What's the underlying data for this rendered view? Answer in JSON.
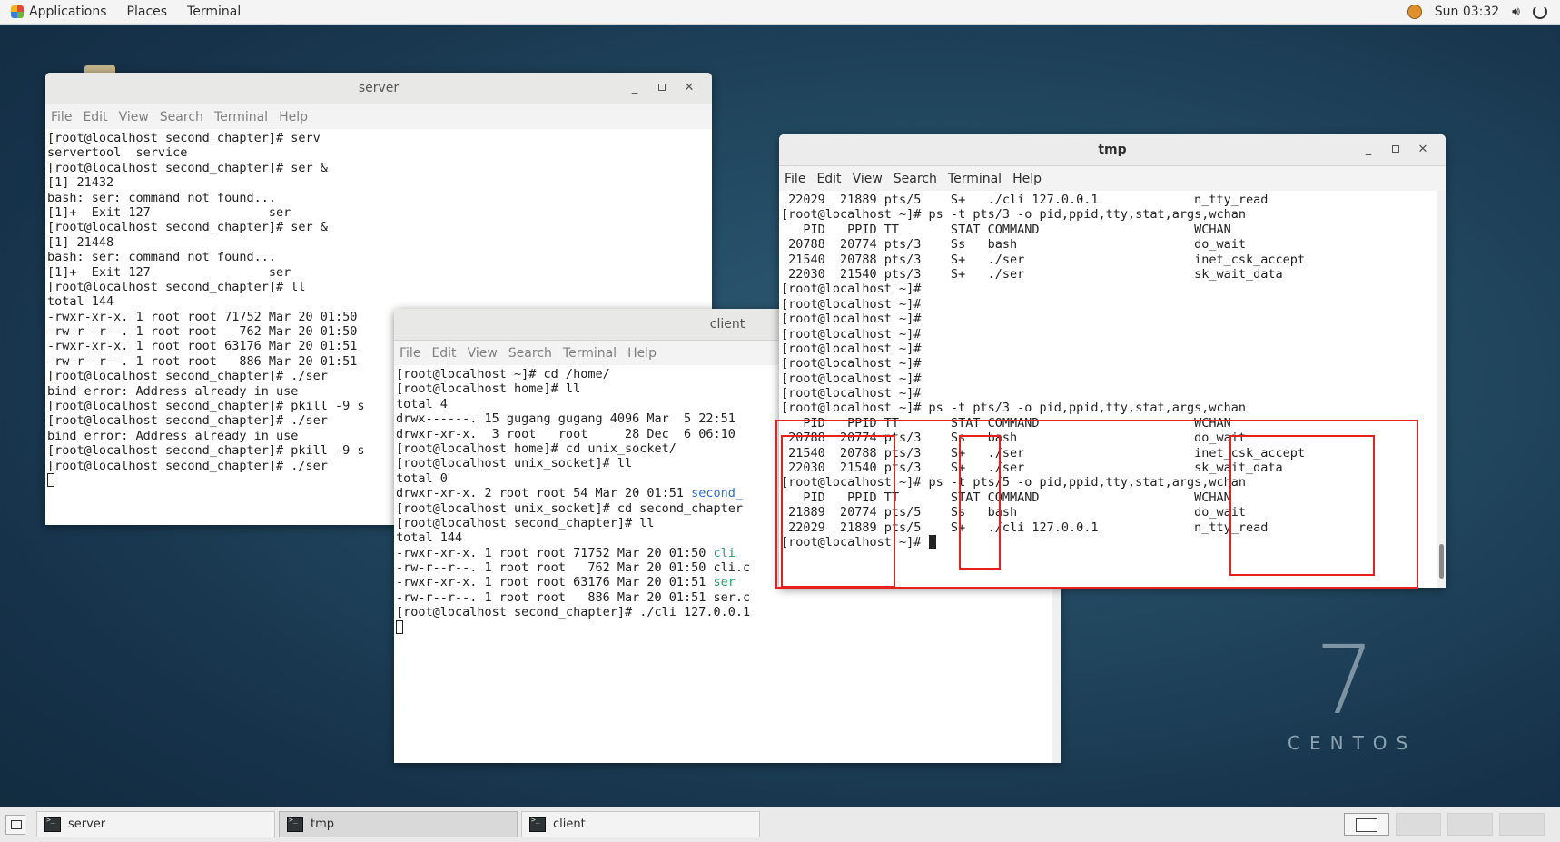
{
  "topbar": {
    "applications": "Applications",
    "places": "Places",
    "terminal": "Terminal",
    "clock": "Sun 03:32"
  },
  "server": {
    "title": "server",
    "menu": [
      "File",
      "Edit",
      "View",
      "Search",
      "Terminal",
      "Help"
    ],
    "lines": [
      "[root@localhost second_chapter]# serv",
      "servertool  service",
      "[root@localhost second_chapter]# ser &",
      "[1] 21432",
      "bash: ser: command not found...",
      "[1]+  Exit 127                ser",
      "[root@localhost second_chapter]# ser &",
      "[1] 21448",
      "bash: ser: command not found...",
      "[1]+  Exit 127                ser",
      "[root@localhost second_chapter]# ll",
      "total 144",
      "-rwxr-xr-x. 1 root root 71752 Mar 20 01:50",
      "-rw-r--r--. 1 root root   762 Mar 20 01:50",
      "-rwxr-xr-x. 1 root root 63176 Mar 20 01:51",
      "-rw-r--r--. 1 root root   886 Mar 20 01:51",
      "[root@localhost second_chapter]# ./ser",
      "bind error: Address already in use",
      "[root@localhost second_chapter]# pkill -9 s",
      "[root@localhost second_chapter]# ./ser",
      "bind error: Address already in use",
      "[root@localhost second_chapter]# pkill -9 s",
      "[root@localhost second_chapter]# ./ser"
    ]
  },
  "client": {
    "title": "client",
    "menu": [
      "File",
      "Edit",
      "View",
      "Search",
      "Terminal",
      "Help"
    ],
    "lines": [
      {
        "t": "[root@localhost ~]# cd /home/"
      },
      {
        "t": "[root@localhost home]# ll"
      },
      {
        "t": "total 4"
      },
      {
        "t": "drwx------. 15 gugang gugang 4096 Mar  5 22:51"
      },
      {
        "t": "drwxr-xr-x.  3 root   root     28 Dec  6 06:10"
      },
      {
        "t": "[root@localhost home]# cd unix_socket/"
      },
      {
        "t": "[root@localhost unix_socket]# ll"
      },
      {
        "t": "total 0"
      },
      {
        "t": "drwxr-xr-x. 2 root root 54 Mar 20 01:51 ",
        "c": "second_",
        "cls": "blue"
      },
      {
        "t": "[root@localhost unix_socket]# cd second_chapter"
      },
      {
        "t": "[root@localhost second_chapter]# ll"
      },
      {
        "t": "total 144"
      },
      {
        "t": "-rwxr-xr-x. 1 root root 71752 Mar 20 01:50 ",
        "c": "cli",
        "cls": "green"
      },
      {
        "t": "-rw-r--r--. 1 root root   762 Mar 20 01:50 cli.c"
      },
      {
        "t": "-rwxr-xr-x. 1 root root 63176 Mar 20 01:51 ",
        "c": "ser",
        "cls": "green"
      },
      {
        "t": "-rw-r--r--. 1 root root   886 Mar 20 01:51 ser.c"
      },
      {
        "t": "[root@localhost second_chapter]# ./cli 127.0.0.1"
      }
    ]
  },
  "tmp": {
    "title": "tmp",
    "menu": [
      "File",
      "Edit",
      "View",
      "Search",
      "Terminal",
      "Help"
    ],
    "lines": [
      " 22029  21889 pts/5    S+   ./cli 127.0.0.1             n_tty_read",
      "[root@localhost ~]# ps -t pts/3 -o pid,ppid,tty,stat,args,wchan",
      "   PID   PPID TT       STAT COMMAND                     WCHAN",
      " 20788  20774 pts/3    Ss   bash                        do_wait",
      " 21540  20788 pts/3    S+   ./ser                       inet_csk_accept",
      " 22030  21540 pts/3    S+   ./ser                       sk_wait_data",
      "[root@localhost ~]#",
      "[root@localhost ~]#",
      "[root@localhost ~]#",
      "[root@localhost ~]#",
      "[root@localhost ~]#",
      "[root@localhost ~]#",
      "[root@localhost ~]#",
      "[root@localhost ~]#",
      "[root@localhost ~]# ps -t pts/3 -o pid,ppid,tty,stat,args,wchan",
      "   PID   PPID TT       STAT COMMAND                     WCHAN",
      " 20788  20774 pts/3    Ss   bash                        do_wait",
      " 21540  20788 pts/3    S+   ./ser                       inet_csk_accept",
      " 22030  21540 pts/3    S+   ./ser                       sk_wait_data",
      "[root@localhost ~]# ps -t pts/5 -o pid,ppid,tty,stat,args,wchan",
      "   PID   PPID TT       STAT COMMAND                     WCHAN",
      " 21889  20774 pts/5    Ss   bash                        do_wait",
      " 22029  21889 pts/5    S+   ./cli 127.0.0.1             n_tty_read",
      "[root@localhost ~]# "
    ]
  },
  "desktop": {
    "logo_number": "7",
    "logo_word": "CENTOS"
  },
  "taskbar": {
    "tasks": [
      {
        "label": "server"
      },
      {
        "label": "tmp"
      },
      {
        "label": "client"
      }
    ]
  }
}
